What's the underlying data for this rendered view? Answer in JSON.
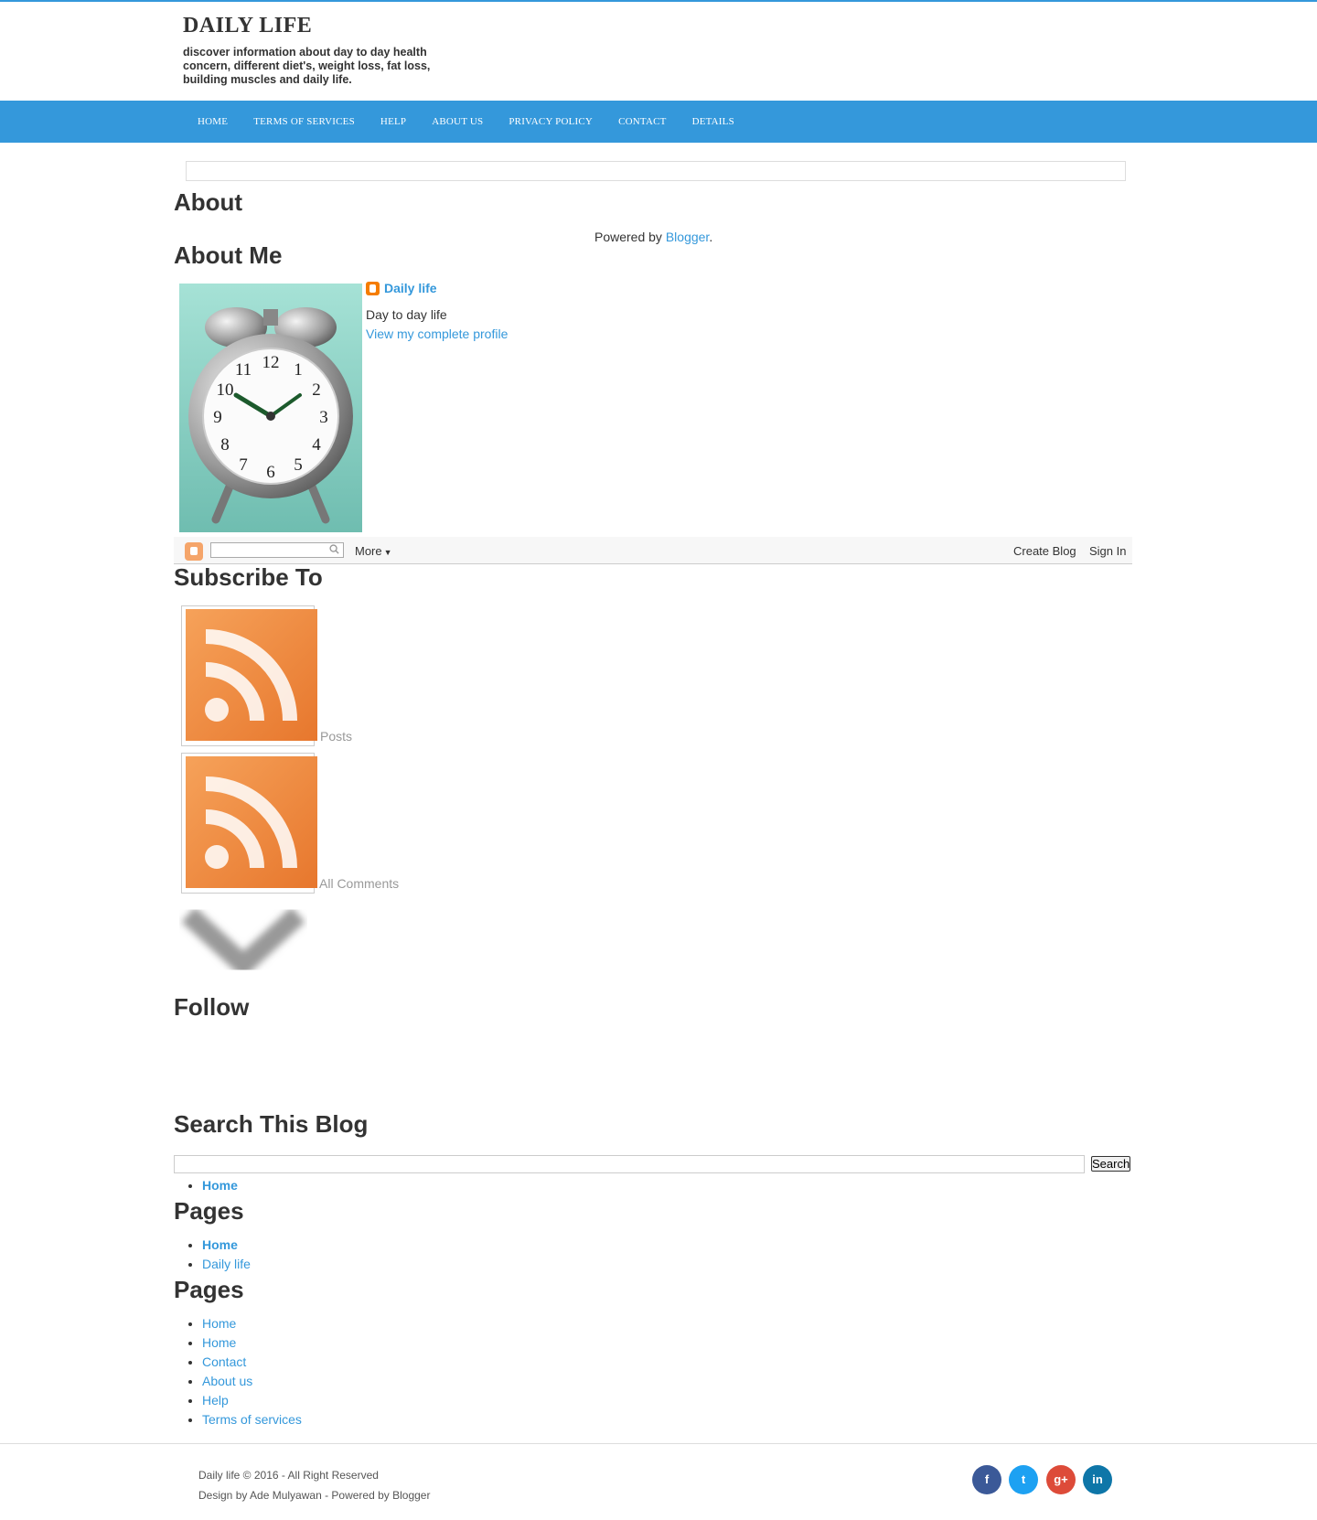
{
  "site": {
    "title": "DAILY LIFE",
    "description": "discover information about day to day health concern, different diet's, weight loss, fat loss, building muscles and daily life."
  },
  "nav": [
    "HOME",
    "TERMS OF SERVICES",
    "HELP",
    "ABOUT US",
    "PRIVACY POLICY",
    "CONTACT",
    "DETAILS"
  ],
  "about": {
    "heading": "About",
    "powered_prefix": "Powered by ",
    "powered_link": "Blogger",
    "powered_suffix": "."
  },
  "about_me": {
    "heading": "About Me",
    "name": "Daily life",
    "description": "Day to day life",
    "profile_link": "View my complete profile"
  },
  "navbar_widget": {
    "more": "More",
    "create_blog": "Create Blog",
    "sign_in": "Sign In"
  },
  "subscribe": {
    "heading": "Subscribe To",
    "posts_label": "Posts",
    "comments_label": "All Comments"
  },
  "follow": {
    "heading": "Follow"
  },
  "search": {
    "heading": "Search This Blog",
    "button": "Search",
    "value": "",
    "list": [
      "Home"
    ]
  },
  "pages1": {
    "heading": "Pages",
    "items": [
      "Home",
      "Daily life"
    ]
  },
  "pages2": {
    "heading": "Pages",
    "items": [
      "Home",
      "Home",
      "Contact",
      "About us",
      "Help",
      "Terms of services"
    ]
  },
  "footer": {
    "copyright": "Daily life © 2016 - All Right Reserved",
    "credit": "Design by Ade Mulyawan - Powered by Blogger"
  },
  "social": [
    {
      "icon": "facebook-icon",
      "glyph": "f",
      "color": "#3b5998"
    },
    {
      "icon": "twitter-icon",
      "glyph": "t",
      "color": "#1da1f2"
    },
    {
      "icon": "google-plus-icon",
      "glyph": "g+",
      "color": "#dd4b39"
    },
    {
      "icon": "linkedin-icon",
      "glyph": "in",
      "color": "#0e76a8"
    }
  ],
  "colors": {
    "accent": "#3498db",
    "rss": "#e7772d"
  }
}
